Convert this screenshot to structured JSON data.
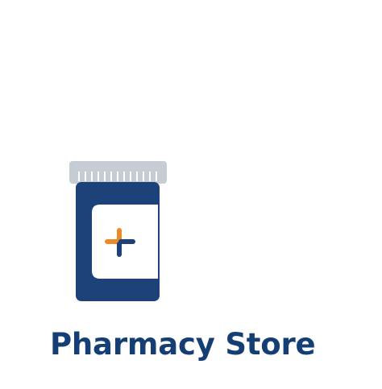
{
  "brand": {
    "name": "Pharmacy Store"
  },
  "icons": {
    "bottle": "pill-bottle-icon",
    "cross": "medical-cross-icon"
  },
  "colors": {
    "bottle_body": "#1d4179",
    "bottle_cap": "#c6ccd3",
    "label": "#ffffff",
    "cross_orange": "#ec8a2a",
    "cross_blue": "#1d4179",
    "brand_text": "#153f74"
  }
}
